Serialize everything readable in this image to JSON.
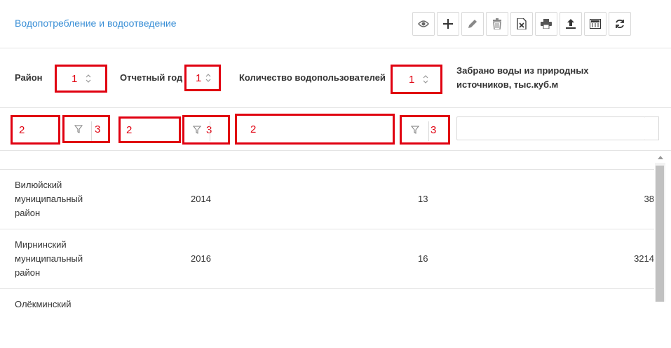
{
  "header": {
    "title": "Водопотребление и водоотведение",
    "toolbar": [
      {
        "icon": "eye-icon"
      },
      {
        "icon": "plus-icon"
      },
      {
        "icon": "pencil-icon"
      },
      {
        "icon": "trash-icon"
      },
      {
        "icon": "excel-icon"
      },
      {
        "icon": "print-icon"
      },
      {
        "icon": "upload-icon"
      },
      {
        "icon": "calculator-icon"
      },
      {
        "icon": "refresh-icon"
      }
    ]
  },
  "columns": [
    {
      "label": "Район",
      "sort_marker": "1"
    },
    {
      "label": "Отчетный год",
      "sort_marker": "1"
    },
    {
      "label": "Количество водопользователей",
      "sort_marker": "1"
    },
    {
      "label": "Забрано воды из природных источников, тыс.куб.м"
    }
  ],
  "filters": [
    {
      "input_marker": "2",
      "filter_marker": "3"
    },
    {
      "input_marker": "2",
      "filter_marker": "3"
    },
    {
      "input_marker": "2",
      "filter_marker": "3"
    },
    {
      "value": ""
    }
  ],
  "rows": [
    {
      "district": "Вилюйский муниципальный район",
      "year": "2014",
      "users": "13",
      "water": "38"
    },
    {
      "district": "Мирнинский муниципальный район",
      "year": "2016",
      "users": "16",
      "water": "3214"
    },
    {
      "district": "Олёкминский",
      "year": "",
      "users": "",
      "water": ""
    }
  ],
  "colors": {
    "accent": "#3a8fd6",
    "annotation": "#e00010"
  }
}
